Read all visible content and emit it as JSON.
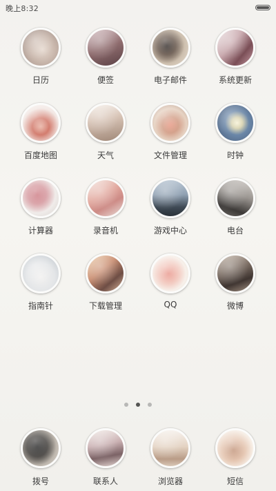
{
  "status_bar": {
    "time": "晚上8:32",
    "battery_icon": "battery-icon"
  },
  "home_apps": [
    {
      "label": "日历",
      "icon": "calendar-icon"
    },
    {
      "label": "便签",
      "icon": "notes-icon"
    },
    {
      "label": "电子邮件",
      "icon": "email-icon"
    },
    {
      "label": "系统更新",
      "icon": "system-update-icon"
    },
    {
      "label": "百度地图",
      "icon": "baidu-map-icon"
    },
    {
      "label": "天气",
      "icon": "weather-icon"
    },
    {
      "label": "文件管理",
      "icon": "file-manager-icon"
    },
    {
      "label": "时钟",
      "icon": "clock-icon"
    },
    {
      "label": "计算器",
      "icon": "calculator-icon"
    },
    {
      "label": "录音机",
      "icon": "recorder-icon"
    },
    {
      "label": "游戏中心",
      "icon": "game-center-icon"
    },
    {
      "label": "电台",
      "icon": "radio-icon"
    },
    {
      "label": "指南针",
      "icon": "compass-icon"
    },
    {
      "label": "下载管理",
      "icon": "download-manager-icon"
    },
    {
      "label": "QQ",
      "icon": "qq-icon"
    },
    {
      "label": "微博",
      "icon": "weibo-icon"
    }
  ],
  "page_indicator": {
    "total": 3,
    "active": 2
  },
  "dock_apps": [
    {
      "label": "拨号",
      "icon": "dialer-icon"
    },
    {
      "label": "联系人",
      "icon": "contacts-icon"
    },
    {
      "label": "浏览器",
      "icon": "browser-icon"
    },
    {
      "label": "短信",
      "icon": "sms-icon"
    }
  ]
}
